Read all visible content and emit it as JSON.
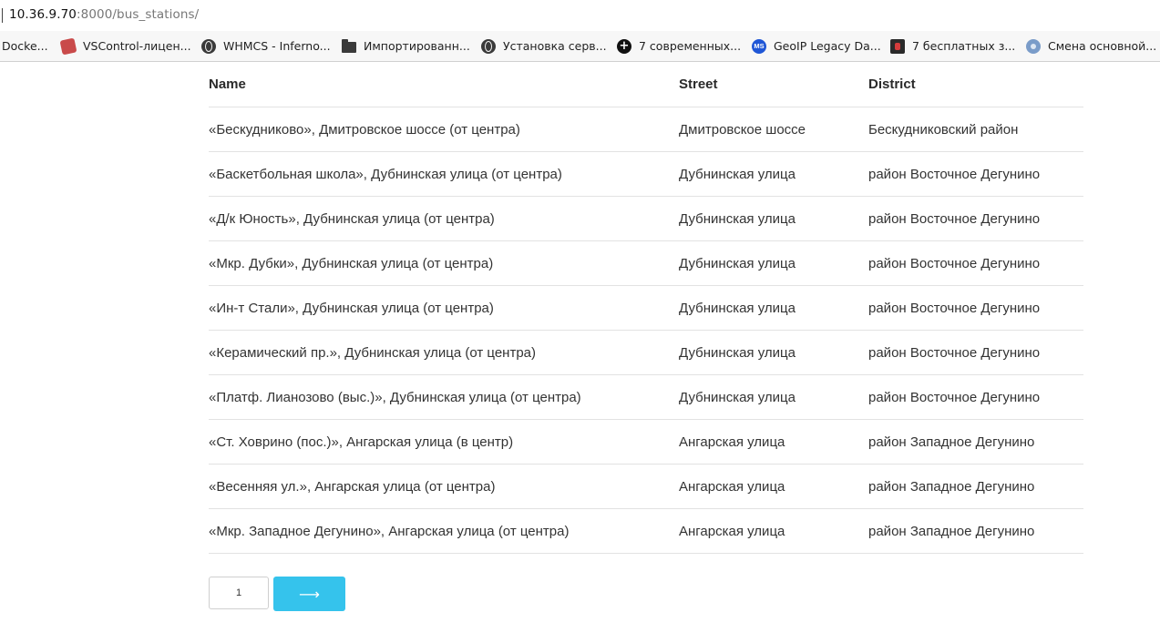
{
  "browser": {
    "url_host": "10.36.9.70",
    "url_path": ":8000/bus_stations/",
    "bookmarks": [
      {
        "label": "Docke...",
        "icon": "none"
      },
      {
        "label": "VSControl-лицен...",
        "icon": "vscontrol-icon"
      },
      {
        "label": "WHMCS - Inferno...",
        "icon": "globe-icon"
      },
      {
        "label": "Импортированн...",
        "icon": "folder-icon"
      },
      {
        "label": "Установка серв...",
        "icon": "globe-icon"
      },
      {
        "label": "7 современных...",
        "icon": "plus-circle-icon"
      },
      {
        "label": "GeoIP Legacy Da...",
        "icon": "ms-icon",
        "icon_text": "MS"
      },
      {
        "label": "7 бесплатных з...",
        "icon": "dark-site-icon"
      },
      {
        "label": "Смена основной...",
        "icon": "gear-globe-icon"
      }
    ]
  },
  "table": {
    "headers": [
      "Name",
      "Street",
      "District"
    ],
    "rows": [
      [
        "«Бескудниково», Дмитровское шоссе (от центра)",
        "Дмитровское шоссе",
        "Бескудниковский район"
      ],
      [
        "«Баскетбольная школа», Дубнинская улица (от центра)",
        "Дубнинская улица",
        "район Восточное Дегунино"
      ],
      [
        "«Д/к Юность», Дубнинская улица (от центра)",
        "Дубнинская улица",
        "район Восточное Дегунино"
      ],
      [
        "«Мкр. Дубки», Дубнинская улица (от центра)",
        "Дубнинская улица",
        "район Восточное Дегунино"
      ],
      [
        "«Ин-т Стали», Дубнинская улица (от центра)",
        "Дубнинская улица",
        "район Восточное Дегунино"
      ],
      [
        "«Керамический пр.», Дубнинская улица (от центра)",
        "Дубнинская улица",
        "район Восточное Дегунино"
      ],
      [
        "«Платф. Лианозово (выс.)», Дубнинская улица (от центра)",
        "Дубнинская улица",
        "район Восточное Дегунино"
      ],
      [
        "«Ст. Ховрино (пос.)», Ангарская улица (в центр)",
        "Ангарская улица",
        "район Западное Дегунино"
      ],
      [
        "«Весенняя ул.», Ангарская улица (от центра)",
        "Ангарская улица",
        "район Западное Дегунино"
      ],
      [
        "«Мкр. Западное Дегунино», Ангарская улица (от центра)",
        "Ангарская улица",
        "район Западное Дегунино"
      ]
    ]
  },
  "pagination": {
    "current_page": "1",
    "next_label": "⟶",
    "accent_color": "#35c3ec"
  }
}
